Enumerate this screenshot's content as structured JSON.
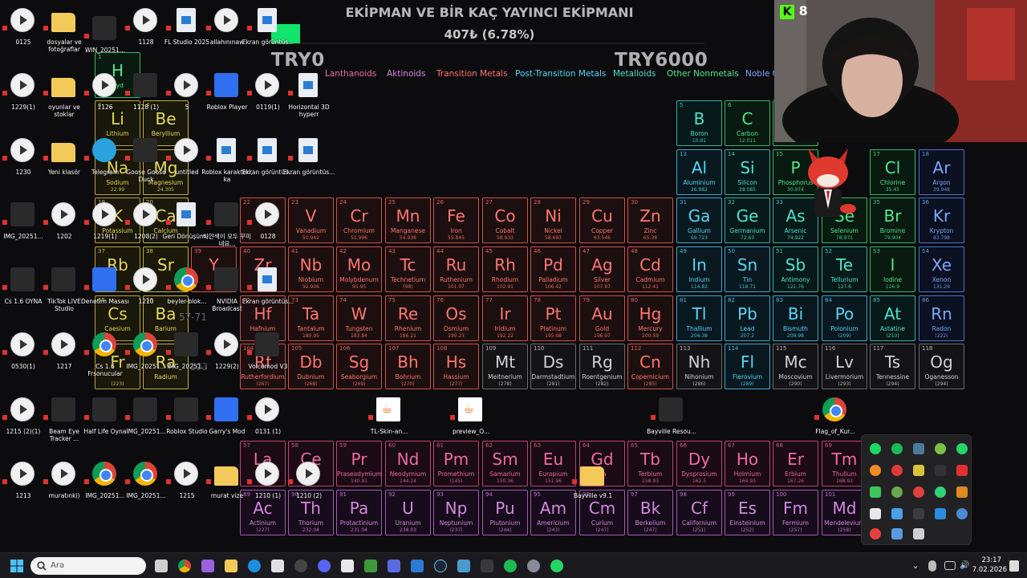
{
  "stream_overlay": {
    "goal_title": "EKİPMAN VE BİR KAÇ YAYINCI EKİPMANI",
    "goal_amount": "407₺ (6.78%)",
    "goal_progress_percent": 6.78,
    "goal_start": "TRY0",
    "goal_end": "TRY6000",
    "kick_viewer_count": "8",
    "accent_color": "#12e36b"
  },
  "legend": [
    {
      "label": "Lanthanoids",
      "color": "#ee6ba4"
    },
    {
      "label": "Aktinoids",
      "color": "#d388e0"
    },
    {
      "label": "Transition Metals",
      "color": "#ff7670"
    },
    {
      "label": "Post-Transition Metals",
      "color": "#56d6f6"
    },
    {
      "label": "Metalloids",
      "color": "#4fe3cc"
    },
    {
      "label": "Other Nonmetals",
      "color": "#4fe890"
    },
    {
      "label": "Noble G",
      "color": "#7da6ff"
    }
  ],
  "elements": [
    {
      "n": "5",
      "s": "B",
      "name": "Boron",
      "m": "10.81",
      "c": "mt"
    },
    {
      "n": "6",
      "s": "C",
      "name": "Carbon",
      "m": "12.011",
      "c": "nm"
    },
    {
      "n": "7",
      "s": "N",
      "name": "Nitr",
      "m": "14.0",
      "c": "nm"
    },
    {
      "n": "13",
      "s": "Al",
      "name": "Aluminium",
      "m": "26.982",
      "c": "pt"
    },
    {
      "n": "14",
      "s": "Si",
      "name": "Silicon",
      "m": "28.085",
      "c": "mt"
    },
    {
      "n": "15",
      "s": "P",
      "name": "Phosphorus",
      "m": "30.974",
      "c": "nm"
    },
    {
      "n": "17",
      "s": "Cl",
      "name": "Chlorine",
      "m": "35.45",
      "c": "nm"
    },
    {
      "n": "18",
      "s": "Ar",
      "name": "Argon",
      "m": "39.948",
      "c": "ng"
    },
    {
      "n": "23",
      "s": "V",
      "name": "Vanadium",
      "m": "50.942",
      "c": "tr"
    },
    {
      "n": "24",
      "s": "Cr",
      "name": "Chromium",
      "m": "51.996",
      "c": "tr"
    },
    {
      "n": "25",
      "s": "Mn",
      "name": "Manganese",
      "m": "54.938",
      "c": "tr"
    },
    {
      "n": "26",
      "s": "Fe",
      "name": "Iron",
      "m": "55.845",
      "c": "tr"
    },
    {
      "n": "27",
      "s": "Co",
      "name": "Cobalt",
      "m": "58.933",
      "c": "tr"
    },
    {
      "n": "28",
      "s": "Ni",
      "name": "Nickel",
      "m": "58.693",
      "c": "tr"
    },
    {
      "n": "29",
      "s": "Cu",
      "name": "Copper",
      "m": "63.546",
      "c": "tr"
    },
    {
      "n": "30",
      "s": "Zn",
      "name": "Zinc",
      "m": "65.38",
      "c": "tr"
    },
    {
      "n": "31",
      "s": "Ga",
      "name": "Gallium",
      "m": "69.723",
      "c": "pt"
    },
    {
      "n": "32",
      "s": "Ge",
      "name": "Germanium",
      "m": "72.63",
      "c": "mt"
    },
    {
      "n": "33",
      "s": "As",
      "name": "Arsenic",
      "m": "74.922",
      "c": "mt"
    },
    {
      "n": "34",
      "s": "Se",
      "name": "Selenium",
      "m": "78.971",
      "c": "nm"
    },
    {
      "n": "35",
      "s": "Br",
      "name": "Bromine",
      "m": "79.904",
      "c": "nm"
    },
    {
      "n": "36",
      "s": "Kr",
      "name": "Krypton",
      "m": "83.798",
      "c": "ng"
    },
    {
      "n": "41",
      "s": "Nb",
      "name": "Niobium",
      "m": "92.906",
      "c": "tr"
    },
    {
      "n": "42",
      "s": "Mo",
      "name": "Molybdenum",
      "m": "95.95",
      "c": "tr"
    },
    {
      "n": "43",
      "s": "Tc",
      "name": "Technetium",
      "m": "(98)",
      "c": "tr"
    },
    {
      "n": "44",
      "s": "Ru",
      "name": "Ruthenium",
      "m": "101.07",
      "c": "tr"
    },
    {
      "n": "45",
      "s": "Rh",
      "name": "Rhodium",
      "m": "102.91",
      "c": "tr"
    },
    {
      "n": "46",
      "s": "Pd",
      "name": "Palladium",
      "m": "106.42",
      "c": "tr"
    },
    {
      "n": "47",
      "s": "Ag",
      "name": "Silver",
      "m": "107.87",
      "c": "tr"
    },
    {
      "n": "48",
      "s": "Cd",
      "name": "Cadmium",
      "m": "112.41",
      "c": "tr"
    },
    {
      "n": "49",
      "s": "In",
      "name": "Indium",
      "m": "114.82",
      "c": "pt"
    },
    {
      "n": "50",
      "s": "Sn",
      "name": "Tin",
      "m": "118.71",
      "c": "pt"
    },
    {
      "n": "51",
      "s": "Sb",
      "name": "Antimony",
      "m": "121.76",
      "c": "mt"
    },
    {
      "n": "52",
      "s": "Te",
      "name": "Tellurium",
      "m": "127.6",
      "c": "mt"
    },
    {
      "n": "53",
      "s": "I",
      "name": "Iodine",
      "m": "126.9",
      "c": "nm"
    },
    {
      "n": "54",
      "s": "Xe",
      "name": "Xenon",
      "m": "131.29",
      "c": "ng"
    },
    {
      "n": "73",
      "s": "Ta",
      "name": "Tantalum",
      "m": "180.95",
      "c": "tr"
    },
    {
      "n": "74",
      "s": "W",
      "name": "Tungsten",
      "m": "183.84",
      "c": "tr"
    },
    {
      "n": "75",
      "s": "Re",
      "name": "Rhenium",
      "m": "186.21",
      "c": "tr"
    },
    {
      "n": "76",
      "s": "Os",
      "name": "Osmium",
      "m": "190.23",
      "c": "tr"
    },
    {
      "n": "77",
      "s": "Ir",
      "name": "Iridium",
      "m": "192.22",
      "c": "tr"
    },
    {
      "n": "78",
      "s": "Pt",
      "name": "Platinum",
      "m": "195.08",
      "c": "tr"
    },
    {
      "n": "79",
      "s": "Au",
      "name": "Gold",
      "m": "196.97",
      "c": "tr"
    },
    {
      "n": "80",
      "s": "Hg",
      "name": "Mercury",
      "m": "200.59",
      "c": "tr"
    },
    {
      "n": "81",
      "s": "Tl",
      "name": "Thallium",
      "m": "204.38",
      "c": "pt"
    },
    {
      "n": "82",
      "s": "Pb",
      "name": "Lead",
      "m": "207.2",
      "c": "pt"
    },
    {
      "n": "83",
      "s": "Bi",
      "name": "Bismuth",
      "m": "208.98",
      "c": "pt"
    },
    {
      "n": "84",
      "s": "Po",
      "name": "Polonium",
      "m": "(209)",
      "c": "pt"
    },
    {
      "n": "85",
      "s": "At",
      "name": "Astatine",
      "m": "(210)",
      "c": "mt"
    },
    {
      "n": "86",
      "s": "Rn",
      "name": "Radon",
      "m": "(222)",
      "c": "ng"
    },
    {
      "n": "105",
      "s": "Db",
      "name": "Dubnium",
      "m": "(268)",
      "c": "tr"
    },
    {
      "n": "106",
      "s": "Sg",
      "name": "Seaborgium",
      "m": "(269)",
      "c": "tr"
    },
    {
      "n": "107",
      "s": "Bh",
      "name": "Bohrium",
      "m": "(270)",
      "c": "tr"
    },
    {
      "n": "108",
      "s": "Hs",
      "name": "Hassium",
      "m": "(277)",
      "c": "tr"
    },
    {
      "n": "109",
      "s": "Mt",
      "name": "Meitnerium",
      "m": "(278)",
      "c": "un"
    },
    {
      "n": "110",
      "s": "Ds",
      "name": "Darmstadtium",
      "m": "(281)",
      "c": "un"
    },
    {
      "n": "111",
      "s": "Rg",
      "name": "Roentgenium",
      "m": "(282)",
      "c": "un"
    },
    {
      "n": "112",
      "s": "Cn",
      "name": "Copernicium",
      "m": "(285)",
      "c": "tr"
    },
    {
      "n": "113",
      "s": "Nh",
      "name": "Nihonium",
      "m": "(286)",
      "c": "un"
    },
    {
      "n": "114",
      "s": "Fl",
      "name": "Flerovium",
      "m": "(289)",
      "c": "pt"
    },
    {
      "n": "115",
      "s": "Mc",
      "name": "Moscovium",
      "m": "(290)",
      "c": "un"
    },
    {
      "n": "116",
      "s": "Lv",
      "name": "Livermorium",
      "m": "(293)",
      "c": "un"
    },
    {
      "n": "117",
      "s": "Ts",
      "name": "Tennessine",
      "m": "(294)",
      "c": "un"
    },
    {
      "n": "118",
      "s": "Og",
      "name": "Oganesson",
      "m": "(294)",
      "c": "un"
    },
    {
      "n": "57",
      "s": "La",
      "name": "",
      "m": "",
      "c": "ln"
    },
    {
      "n": "58",
      "s": "Ce",
      "name": "Ceri",
      "m": "",
      "c": "ln"
    },
    {
      "n": "59",
      "s": "Pr",
      "name": "Praseodymium",
      "m": "140.91",
      "c": "ln"
    },
    {
      "n": "60",
      "s": "Nd",
      "name": "Neodymium",
      "m": "144.24",
      "c": "ln"
    },
    {
      "n": "61",
      "s": "Pm",
      "name": "Promethium",
      "m": "(145)",
      "c": "ln"
    },
    {
      "n": "62",
      "s": "Sm",
      "name": "Samarium",
      "m": "150.36",
      "c": "ln"
    },
    {
      "n": "63",
      "s": "Eu",
      "name": "Europium",
      "m": "151.96",
      "c": "ln"
    },
    {
      "n": "64",
      "s": "Gd",
      "name": "Ga",
      "m": "",
      "c": "ln"
    },
    {
      "n": "65",
      "s": "Tb",
      "name": "Terbium",
      "m": "158.93",
      "c": "ln"
    },
    {
      "n": "66",
      "s": "Dy",
      "name": "Dysprosium",
      "m": "162.5",
      "c": "ln"
    },
    {
      "n": "67",
      "s": "Ho",
      "name": "Holmium",
      "m": "164.93",
      "c": "ln"
    },
    {
      "n": "68",
      "s": "Er",
      "name": "Erbium",
      "m": "167.26",
      "c": "ln"
    },
    {
      "n": "69",
      "s": "Tm",
      "name": "Thulium",
      "m": "168.93",
      "c": "ln"
    },
    {
      "n": "89",
      "s": "Ac",
      "name": "Actinium",
      "m": "(227)",
      "c": "ac"
    },
    {
      "n": "90",
      "s": "Th",
      "name": "Thorium",
      "m": "232.04",
      "c": "ac"
    },
    {
      "n": "91",
      "s": "Pa",
      "name": "Protactinium",
      "m": "231.04",
      "c": "ac"
    },
    {
      "n": "92",
      "s": "U",
      "name": "Uranium",
      "m": "238.03",
      "c": "ac"
    },
    {
      "n": "93",
      "s": "Np",
      "name": "Neptunium",
      "m": "(237)",
      "c": "ac"
    },
    {
      "n": "94",
      "s": "Pu",
      "name": "Plutonium",
      "m": "(244)",
      "c": "ac"
    },
    {
      "n": "95",
      "s": "Am",
      "name": "Americium",
      "m": "(243)",
      "c": "ac"
    },
    {
      "n": "96",
      "s": "Cm",
      "name": "Curium",
      "m": "(247)",
      "c": "ac"
    },
    {
      "n": "97",
      "s": "Bk",
      "name": "Berkelium",
      "m": "(247)",
      "c": "ac"
    },
    {
      "n": "98",
      "s": "Cf",
      "name": "Californium",
      "m": "(251)",
      "c": "ac"
    },
    {
      "n": "99",
      "s": "Es",
      "name": "Einsteinium",
      "m": "(252)",
      "c": "ac"
    },
    {
      "n": "100",
      "s": "Fm",
      "name": "Fermium",
      "m": "(257)",
      "c": "ac"
    },
    {
      "n": "101",
      "s": "Md",
      "name": "Mendelevium",
      "m": "(258)",
      "c": "ac"
    },
    {
      "n": "1",
      "s": "H",
      "name": "Hyd",
      "m": "",
      "c": "nm"
    },
    {
      "n": "3",
      "s": "Li",
      "name": "Lithium",
      "m": "",
      "c": "al"
    },
    {
      "n": "4",
      "s": "Be",
      "name": "Beryllium",
      "m": "",
      "c": "ae"
    },
    {
      "n": "11",
      "s": "Na",
      "name": "Sodium",
      "m": "22.99",
      "c": "al"
    },
    {
      "n": "12",
      "s": "Mg",
      "name": "Magnesium",
      "m": "24.305",
      "c": "ae"
    },
    {
      "n": "37",
      "s": "Rb",
      "name": "",
      "m": "",
      "c": "al"
    },
    {
      "n": "38",
      "s": "Sr",
      "name": "",
      "m": "",
      "c": "ae"
    },
    {
      "n": "55",
      "s": "Cs",
      "name": "Caesium",
      "m": "",
      "c": "al"
    },
    {
      "n": "56",
      "s": "Ba",
      "name": "Barium",
      "m": "",
      "c": "ae"
    },
    {
      "n": "87",
      "s": "Fr",
      "name": "",
      "m": "(223)",
      "c": "al"
    },
    {
      "n": "88",
      "s": "Ra",
      "name": "Radium",
      "m": "",
      "c": "ae"
    },
    {
      "n": "104",
      "s": "Rf",
      "name": "Rutherfordium",
      "m": "(267)",
      "c": "tr"
    },
    {
      "n": "72",
      "s": "Hf",
      "name": "Hafnium",
      "m": "",
      "c": "tr"
    },
    {
      "n": "40",
      "s": "Zr",
      "name": "",
      "m": "",
      "c": "tr"
    },
    {
      "n": "22",
      "s": "Ti",
      "name": "",
      "m": "",
      "c": "tr"
    },
    {
      "n": "39",
      "s": "Y",
      "name": "",
      "m": "",
      "c": "tr"
    },
    {
      "n": "19",
      "s": "K",
      "name": "Potassium",
      "m": "",
      "c": "al"
    },
    {
      "n": "20",
      "s": "Ca",
      "name": "Calcium",
      "m": "",
      "c": "ae"
    }
  ],
  "desktop_icons": [
    {
      "label": "0125",
      "type": "video"
    },
    {
      "label": "dosyalar ve fotoğraflar",
      "type": "folder"
    },
    {
      "label": "WIN_20251...",
      "type": "dark"
    },
    {
      "label": "1128",
      "type": "video"
    },
    {
      "label": "FL Studio 2025",
      "type": "file"
    },
    {
      "label": "allahınınaw",
      "type": "video"
    },
    {
      "label": "Ekran görüntüs...",
      "type": "file"
    },
    {
      "label": "1229(1)",
      "type": "video"
    },
    {
      "label": "oyunlar ve stoklar",
      "type": "folder"
    },
    {
      "label": "1126",
      "type": "video"
    },
    {
      "label": "1128 (1)",
      "type": "dark"
    },
    {
      "label": "5",
      "type": "video"
    },
    {
      "label": "Roblox Player",
      "type": "blue"
    },
    {
      "label": "0119(1)",
      "type": "video"
    },
    {
      "label": "Horizontal 3D hyperr",
      "type": "file"
    },
    {
      "label": "1230",
      "type": "video"
    },
    {
      "label": "Yeni klasör",
      "type": "folder"
    },
    {
      "label": "Telegram",
      "type": "tele"
    },
    {
      "label": "Goose Goose Duck",
      "type": "dark"
    },
    {
      "label": "untitled",
      "type": "video"
    },
    {
      "label": "Roblox karakteri, ka",
      "type": "file"
    },
    {
      "label": "Ekran görüntüs...",
      "type": "file"
    },
    {
      "label": "Ekran görüntüs...",
      "type": "file"
    },
    {
      "label": "IMG_20251...",
      "type": "dark"
    },
    {
      "label": "1202",
      "type": "video"
    },
    {
      "label": "1219(1)",
      "type": "video"
    },
    {
      "label": "1208(2)",
      "type": "video"
    },
    {
      "label": "Geri Dönüşüm...",
      "type": "file"
    },
    {
      "label": "하얀색이 모두 꾸미네요...",
      "type": "dark"
    },
    {
      "label": "0128",
      "type": "video"
    },
    {
      "label": "Cs 1.6 OYNA",
      "type": "dark"
    },
    {
      "label": "TikTok LIVE Studio",
      "type": "dark"
    },
    {
      "label": "Denetim Masası",
      "type": "blue"
    },
    {
      "label": "1210",
      "type": "video"
    },
    {
      "label": "beyler-blok...",
      "type": "chrome"
    },
    {
      "label": "NVIDIA Broadcast",
      "type": "dark"
    },
    {
      "label": "Ekran görüntüs...",
      "type": "file"
    },
    {
      "label": "0530(1)",
      "type": "video"
    },
    {
      "label": "1217",
      "type": "video"
    },
    {
      "label": "Cs 1.6 Frsonucular",
      "type": "chrome"
    },
    {
      "label": "IMG_20251...",
      "type": "chrome"
    },
    {
      "label": "IMG_20251...",
      "type": "dark"
    },
    {
      "label": "1229(2)",
      "type": "video"
    },
    {
      "label": "Voicemod V3",
      "type": "dark"
    },
    {
      "label": "1215 (2)(1)",
      "type": "video"
    },
    {
      "label": "Beam Eye Tracker ...",
      "type": "dark"
    },
    {
      "label": "Half Life Oyna",
      "type": "dark"
    },
    {
      "label": "IMG_20251...",
      "type": "dark"
    },
    {
      "label": "Roblox Studio",
      "type": "dark"
    },
    {
      "label": "Garry's Mod",
      "type": "blue"
    },
    {
      "label": "0131 (1)",
      "type": "video"
    },
    {
      "label": "TL-Skin-an...",
      "type": "java"
    },
    {
      "label": "preview_O...",
      "type": "java"
    },
    {
      "label": "Bayville Resou...",
      "type": "dark"
    },
    {
      "label": "Flag_of_Kur...",
      "type": "chrome"
    },
    {
      "label": "1213",
      "type": "video"
    },
    {
      "label": "muratınki)",
      "type": "video"
    },
    {
      "label": "IMG_20251...",
      "type": "chrome"
    },
    {
      "label": "IMG_20251...",
      "type": "chrome"
    },
    {
      "label": "1215",
      "type": "video"
    },
    {
      "label": "murat vize",
      "type": "folder"
    },
    {
      "label": "1210 (1)",
      "type": "video"
    },
    {
      "label": "1210 (2)",
      "type": "video"
    },
    {
      "label": "Bayville v9.1",
      "type": "folder"
    }
  ],
  "ghost_texts": {
    "a": "57-71",
    "b": "-103"
  },
  "taskbar": {
    "search_placeholder": "Ara",
    "time": "23:17",
    "date": "7.02.2026"
  }
}
